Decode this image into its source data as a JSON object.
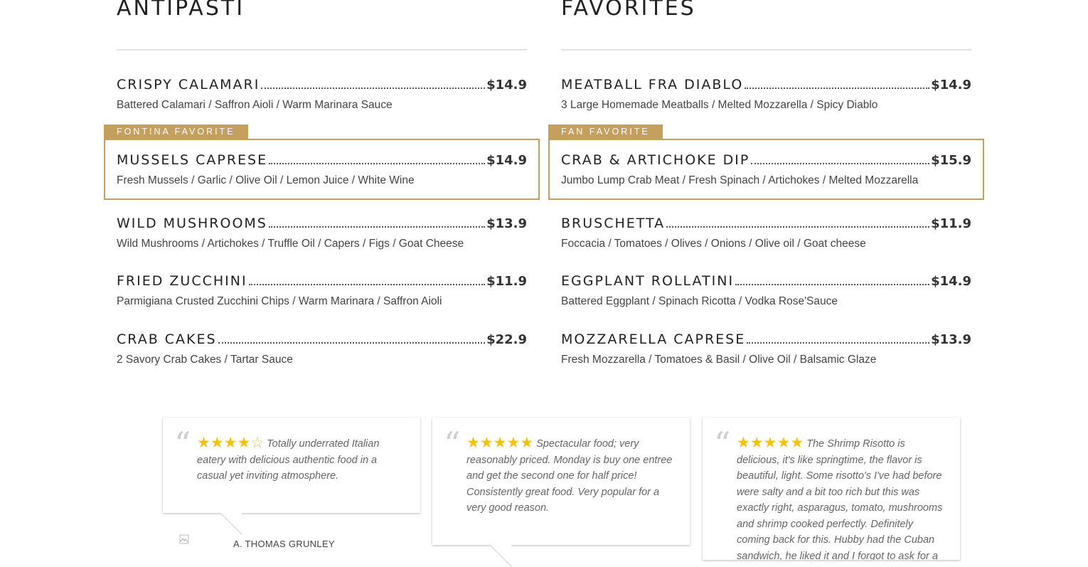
{
  "antipasti": {
    "heading": "ANTIPASTI",
    "items": [
      {
        "name": "CRISPY CALAMARI",
        "price": "$14.9",
        "desc": "Battered Calamari / Saffron Aioli / Warm Marinara Sauce"
      },
      {
        "name": "MUSSELS CAPRESE",
        "price": "$14.9",
        "desc": "Fresh Mussels / Garlic / Olive Oil / Lemon Juice / White Wine",
        "tag": "FONTINA FAVORITE"
      },
      {
        "name": "WILD MUSHROOMS",
        "price": "$13.9",
        "desc": "Wild Mushrooms / Artichokes / Truffle Oil / Capers / Figs / Goat Cheese"
      },
      {
        "name": "FRIED ZUCCHINI",
        "price": "$11.9",
        "desc": "Parmigiana Crusted Zucchini Chips / Warm Marinara / Saffron Aioli"
      },
      {
        "name": "CRAB CAKES",
        "price": "$22.9",
        "desc": "2 Savory Crab Cakes / Tartar Sauce"
      }
    ]
  },
  "favorites": {
    "heading": "FAVORITES",
    "items": [
      {
        "name": "MEATBALL FRA DIABLO",
        "price": "$14.9",
        "desc": "3 Large Homemade Meatballs / Melted Mozzarella / Spicy Diablo"
      },
      {
        "name": "CRAB & ARTICHOKE DIP",
        "price": "$15.9",
        "desc": "Jumbo Lump Crab Meat / Fresh Spinach / Artichokes / Melted Mozzarella",
        "tag": "FAN FAVORITE"
      },
      {
        "name": "BRUSCHETTA",
        "price": "$11.9",
        "desc": "Foccacia / Tomatoes / Olives / Onions / Olive oil / Goat cheese"
      },
      {
        "name": "EGGPLANT ROLLATINI",
        "price": "$14.9",
        "desc": "Battered Eggplant / Spinach Ricotta / Vodka Rose'Sauce"
      },
      {
        "name": "MOZZARELLA CAPRESE",
        "price": "$13.9",
        "desc": "Fresh Mozzarella / Tomatoes & Basil / Olive Oil / Balsamic Glaze"
      }
    ]
  },
  "reviews": [
    {
      "rating": 4,
      "text": "Totally underrated Italian eatery with delicious authentic food in a casual yet inviting atmosphere.",
      "author": "A. THOMAS GRUNLEY"
    },
    {
      "rating": 5,
      "text": "Spectacular food; very reasonably priced. Monday is buy one entree and get the second one for half price! Consistently great food. Very popular for a very good reason."
    },
    {
      "rating": 5,
      "text": "The Shrimp Risotto is delicious, it's like springtime, the flavor is beautiful, light. Some risotto's I've had before were salty and a bit too rich but this was exactly right, asparagus, tomato, mushrooms and shrimp cooked perfectly. Definitely coming back for this. Hubby had the Cuban sandwich, he liked it and I forgot to ask for a white wine to"
    }
  ],
  "colors": {
    "accent": "#c49f5e",
    "star": "#f4c20d"
  },
  "icons": {
    "quote": "open-quote-icon",
    "star": "star-icon",
    "avatar": "broken-image-icon"
  }
}
